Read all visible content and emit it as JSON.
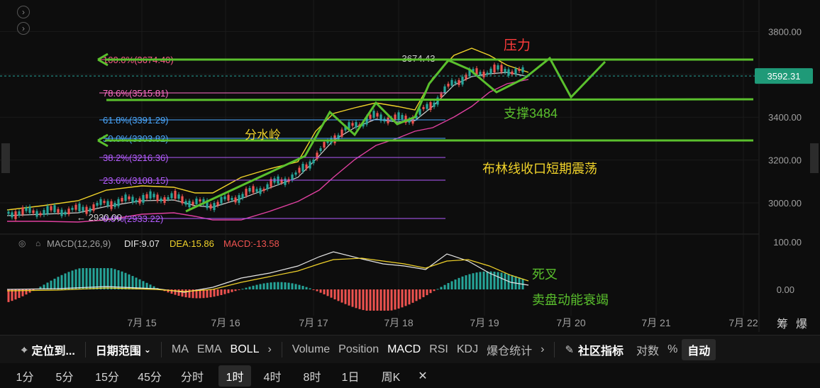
{
  "chart_data": {
    "type": "candlestick",
    "price_axis": {
      "ticks": [
        "3800.00",
        "3600.00",
        "3400.00",
        "3200.00",
        "3000.00"
      ],
      "current_price": "3592.31"
    },
    "time_axis": {
      "ticks": [
        "7月 15",
        "7月 16",
        "7月 17",
        "7月 18",
        "7月 19",
        "7月 20",
        "7月 21",
        "7月 22"
      ]
    },
    "fib_levels": [
      {
        "label": "100.0%(3674.40)",
        "color": "#ff5a8a"
      },
      {
        "label": "78.6%(3515.81)",
        "color": "#ff6ec7"
      },
      {
        "label": "61.8%(3391.29)",
        "color": "#4aa8ff"
      },
      {
        "label": "50.0%(3303.82)",
        "color": "#4aa8ff"
      },
      {
        "label": "38.2%(3216.36)",
        "color": "#b45cff"
      },
      {
        "label": "23.6%(3108.15)",
        "color": "#b45cff"
      },
      {
        "label": "0.0%(2933.22)",
        "color": "#b45cff"
      }
    ],
    "high_marker": "3674.43",
    "low_marker": "2930.00",
    "annotations": {
      "resistance": "压力",
      "support": "支撑3484",
      "watershed": "分水岭",
      "boll_note": "布林线收口短期震荡",
      "death_cross": "死叉",
      "sell_exhaust": "卖盘动能衰竭"
    },
    "macd": {
      "title": "MACD(12,26,9)",
      "dif": "DIF:9.07",
      "dea": "DEA:15.86",
      "macd": "MACD:-13.58",
      "axis": [
        "100.00",
        "0.00"
      ]
    },
    "colors": {
      "up": "#26a69a",
      "down": "#ef5350",
      "green_line": "#5ac02d",
      "fib_pink": "#ff6ec7",
      "boll_mid": "#cfcfcf",
      "boll_upper": "#f0d22a",
      "boll_lower": "#e040a0"
    }
  },
  "corner_labels": {
    "chips": "筹",
    "burst": "爆"
  },
  "toolbar": {
    "locate": "定位到...",
    "date_range": "日期范围",
    "indicators_main": [
      "MA",
      "EMA",
      "BOLL"
    ],
    "indicators_sub": [
      "Volume",
      "Position",
      "MACD",
      "RSI",
      "KDJ",
      "爆仓统计"
    ],
    "community": "社区指标",
    "log": "对数",
    "pct": "%",
    "auto": "自动"
  },
  "timeframes": [
    "1分",
    "5分",
    "15分",
    "45分",
    "分时",
    "1时",
    "4时",
    "8时",
    "1日",
    "周K"
  ]
}
